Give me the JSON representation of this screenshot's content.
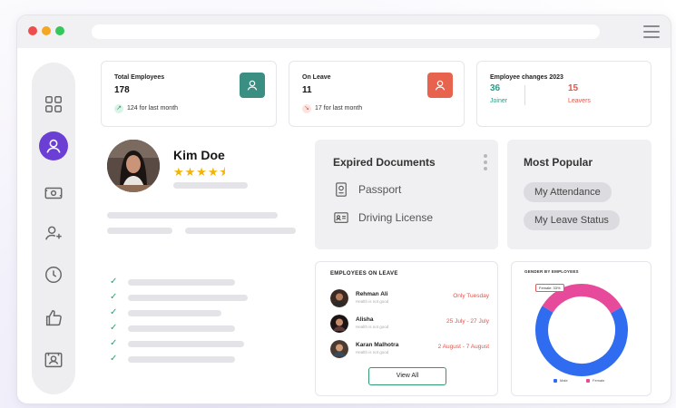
{
  "stats": {
    "total": {
      "label": "Total Employees",
      "value": "178",
      "note": "124 for last month",
      "arrow": "↗"
    },
    "leave": {
      "label": "On Leave",
      "value": "11",
      "note": "17 for last month",
      "arrow": "↘"
    },
    "changes": {
      "label": "Employee changes 2023",
      "joiner_value": "36",
      "joiner_label": "Joiner",
      "leavers_value": "15",
      "leavers_label": "Leavers"
    }
  },
  "profile": {
    "name": "Kim Doe",
    "stars": "★★★★⯨",
    "rating": 4.5
  },
  "expired_documents": {
    "title": "Expired Documents",
    "items": [
      "Passport",
      "Driving License"
    ]
  },
  "most_popular": {
    "title": "Most Popular",
    "items": [
      "My Attendance",
      "My Leave Status"
    ]
  },
  "employees_on_leave": {
    "title": "EMPLOYEES ON LEAVE",
    "rows": [
      {
        "name": "Rehman Ali",
        "sub": "Health is not good",
        "date": "Only Tuesday"
      },
      {
        "name": "Alisha",
        "sub": "Health is not good",
        "date": "25 July - 27 July"
      },
      {
        "name": "Karan Malhotra",
        "sub": "Health is not good",
        "date": "2 August - 7 August"
      }
    ],
    "button": "View All"
  },
  "gender": {
    "title": "GENDER BY EMPLOYEES",
    "tooltip": "Female: 33%",
    "legend": [
      "Male",
      "Female"
    ],
    "male_share": 0.67,
    "female_share": 0.33,
    "colors": {
      "male": "#2f6cf0",
      "female": "#e84a9b"
    }
  },
  "colors": {
    "accent": "#6b3fd4",
    "teal": "#3a8f82",
    "coral": "#e8634e",
    "green": "#2aa36b",
    "red": "#e0554a"
  }
}
